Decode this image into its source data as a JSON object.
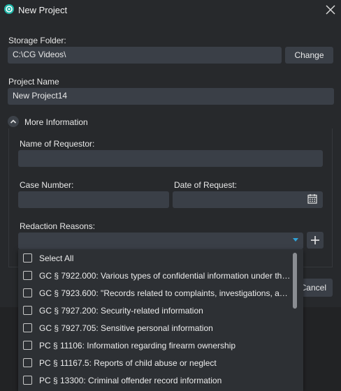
{
  "window": {
    "title": "New Project",
    "app_icon": "logo-icon",
    "close_icon": "close-icon"
  },
  "storage": {
    "label": "Storage Folder:",
    "value": "C:\\CG Videos\\",
    "change_label": "Change"
  },
  "project": {
    "label": "Project Name",
    "value": "New Project14"
  },
  "more_info": {
    "label": "More Information",
    "toggle_icon": "chevron-up-icon",
    "requestor_label": "Name of Requestor:",
    "requestor_value": "",
    "case_label": "Case Number:",
    "case_value": "",
    "date_label": "Date of Request:",
    "date_value": "",
    "calendar_icon": "calendar-icon",
    "reasons_label": "Redaction Reasons:",
    "reasons_value": "",
    "add_icon": "plus-icon",
    "dropdown_icon": "chevron-down-icon"
  },
  "dropdown": {
    "options": [
      {
        "label": "Select All",
        "checked": false
      },
      {
        "label": "GC § 7922.000: Various types of confidential information under the...",
        "checked": false
      },
      {
        "label": "GC § 7923.600: \"Records related to complaints, investigations, and...",
        "checked": false
      },
      {
        "label": "GC § 7927.200: Security-related information",
        "checked": false
      },
      {
        "label": "GC § 7927.705: Sensitive personal information",
        "checked": false
      },
      {
        "label": "PC § 11106: Information regarding firearm ownership",
        "checked": false
      },
      {
        "label": "PC § 11167.5: Reports of child abuse or neglect",
        "checked": false
      },
      {
        "label": "PC § 13300: Criminal offender record information",
        "checked": false
      }
    ]
  },
  "footer": {
    "cancel_label": "Cancel"
  },
  "colors": {
    "accent": "#2fa2d8",
    "background": "#27292c",
    "field": "#3a3f47"
  }
}
